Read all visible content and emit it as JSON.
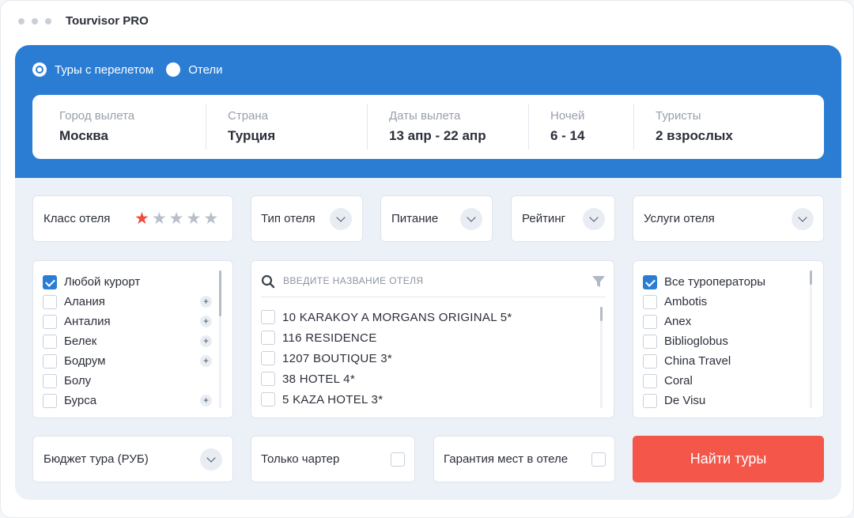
{
  "app": {
    "title": "Tourvisor PRO"
  },
  "search_type": [
    {
      "label": "Туры с перелетом",
      "selected": true
    },
    {
      "label": "Отели",
      "selected": false
    }
  ],
  "search_fields": [
    {
      "label": "Город вылета",
      "value": "Москва"
    },
    {
      "label": "Страна",
      "value": "Турция"
    },
    {
      "label": "Даты вылета",
      "value": "13 апр - 22 апр"
    },
    {
      "label": "Ночей",
      "value": "6 - 14"
    },
    {
      "label": "Туристы",
      "value": "2 взрослых"
    }
  ],
  "filters": {
    "hotel_class": {
      "label": "Класс отеля",
      "stars_total": 5,
      "stars_selected": 1
    },
    "hotel_type": "Тип отеля",
    "meals": "Питание",
    "rating": "Рейтинг",
    "services": "Услуги отеля"
  },
  "resorts": [
    {
      "label": "Любой курорт",
      "checked": true,
      "expandable": false
    },
    {
      "label": "Алания",
      "checked": false,
      "expandable": true
    },
    {
      "label": "Анталия",
      "checked": false,
      "expandable": true
    },
    {
      "label": "Белек",
      "checked": false,
      "expandable": true
    },
    {
      "label": "Бодрум",
      "checked": false,
      "expandable": true
    },
    {
      "label": "Болу",
      "checked": false,
      "expandable": false
    },
    {
      "label": "Бурса",
      "checked": false,
      "expandable": true
    }
  ],
  "hotel_search": {
    "placeholder": "введите название отеля"
  },
  "hotels": [
    "10 KARAKOY A MORGANS ORIGINAL 5*",
    "116 RESIDENCE",
    "1207 BOUTIQUE 3*",
    "38 HOTEL 4*",
    "5 KAZA HOTEL 3*"
  ],
  "operators": [
    {
      "label": "Все туроператоры",
      "checked": true
    },
    {
      "label": "Ambotis",
      "checked": false
    },
    {
      "label": "Anex",
      "checked": false
    },
    {
      "label": "Biblioglobus",
      "checked": false
    },
    {
      "label": "China Travel",
      "checked": false
    },
    {
      "label": "Coral",
      "checked": false
    },
    {
      "label": "De Visu",
      "checked": false
    }
  ],
  "bottom": {
    "budget": "Бюджет тура (РУБ)",
    "charter_only": "Только чартер",
    "guaranteed_rooms": "Гарантия мест в отеле",
    "search_button": "Найти туры"
  },
  "colors": {
    "primary": "#2b7dd4",
    "accent": "#f5564a",
    "star_active": "#f04b3c"
  }
}
